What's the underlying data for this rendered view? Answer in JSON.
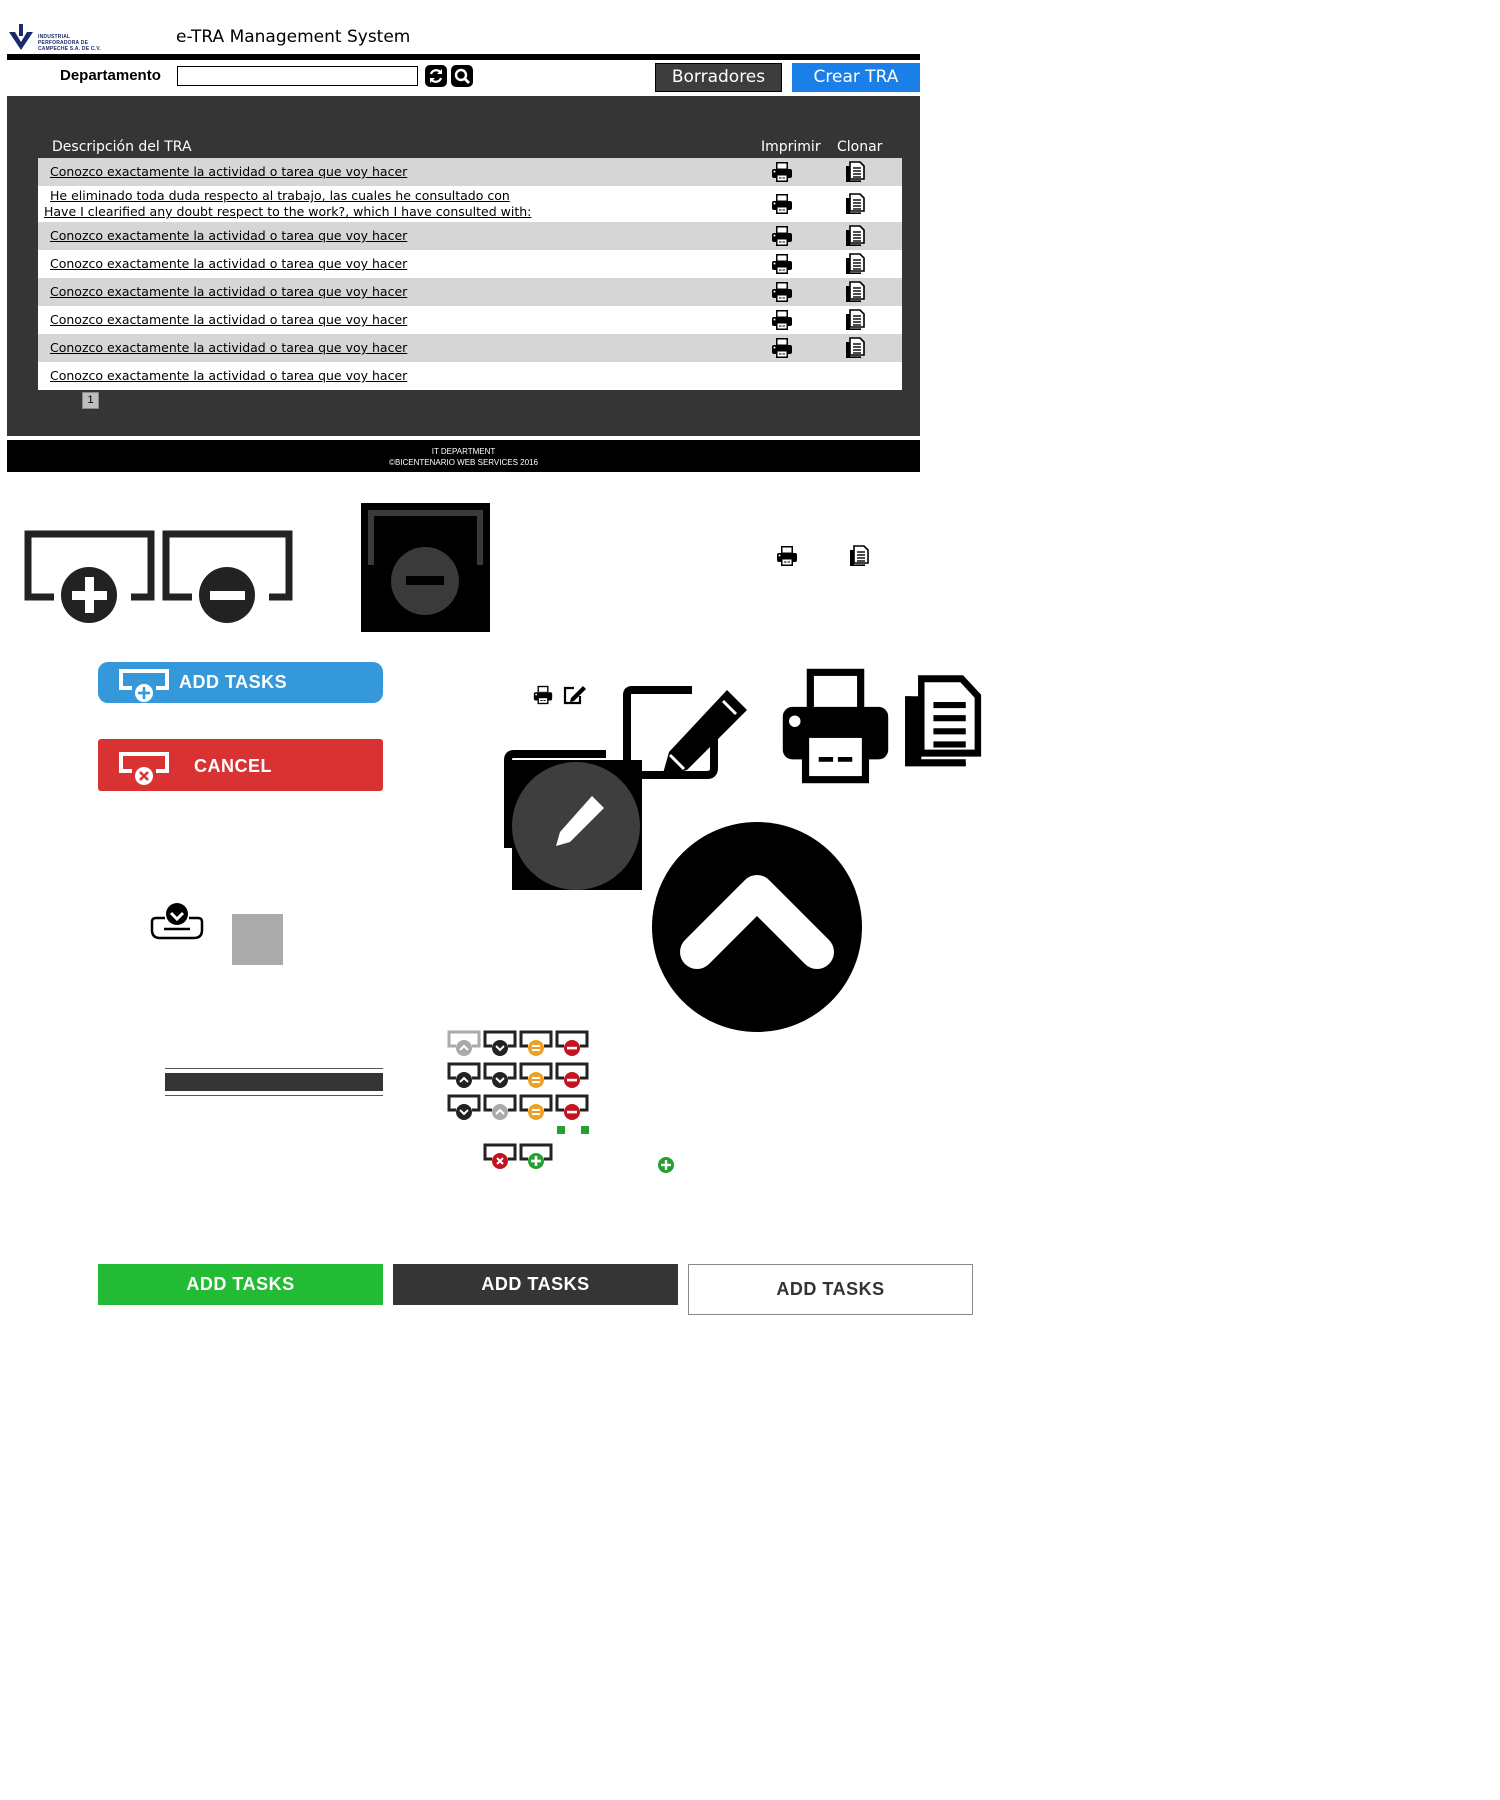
{
  "header": {
    "logo_text": "INDUSTRIAL PERFORADORA DE CAMPECHE S.A. DE C.V.",
    "app_title": "e-TRA Management System"
  },
  "toolbar": {
    "department_label": "Departamento",
    "department_value": "",
    "drafts_label": "Borradores",
    "create_label": "Crear TRA"
  },
  "table": {
    "col_description": "Descripción del TRA",
    "col_print": "Imprimir",
    "col_clone": "Clonar",
    "rows": [
      {
        "desc": "Conozco exactamente la actividad o tarea que voy hacer",
        "desc2": ""
      },
      {
        "desc": "He eliminado toda duda respecto al trabajo, las cuales he consultado con",
        "desc2": "Have I clearified any doubt respect to the work?, which I have consulted with:"
      },
      {
        "desc": "Conozco exactamente la actividad o tarea que voy hacer",
        "desc2": ""
      },
      {
        "desc": "Conozco exactamente la actividad o tarea que voy hacer",
        "desc2": ""
      },
      {
        "desc": "Conozco exactamente la actividad o tarea que voy hacer",
        "desc2": ""
      },
      {
        "desc": "Conozco exactamente la actividad o tarea que voy hacer",
        "desc2": ""
      },
      {
        "desc": "Conozco exactamente la actividad o tarea que voy hacer",
        "desc2": ""
      },
      {
        "desc": "Conozco exactamente la actividad o tarea que voy hacer",
        "desc2": ""
      }
    ],
    "page": "1"
  },
  "footer": {
    "line1": "IT DEPARTMENT",
    "line2": "©BICENTENARIO WEB SERVICES 2016"
  },
  "sprites": {
    "add_tasks_label": "ADD TASKS",
    "cancel_label": "CANCEL",
    "green_label": "ADD TASKS",
    "dark_label": "ADD TASKS",
    "outline_label": "ADD TASKS"
  },
  "colors": {
    "blue": "#3498db",
    "red": "#d93232",
    "green": "#22bb33",
    "dark": "#353535",
    "create": "#1a7fe6"
  }
}
